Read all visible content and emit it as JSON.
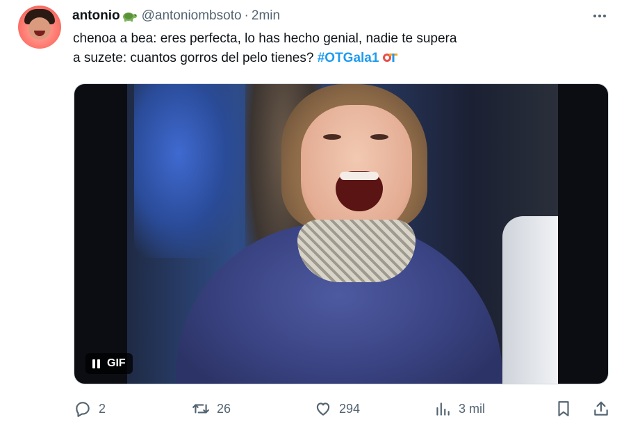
{
  "author": {
    "name": "antonio",
    "name_emoji_icon": "turtle-icon",
    "handle": "@antoniombsoto",
    "separator": "·",
    "time": "2min"
  },
  "tweet": {
    "line1": "chenoa a bea: eres perfecta, lo has hecho genial, nadie te supera",
    "line2_prefix": "a suzete: cuantos gorros del pelo tienes?",
    "hashtag": "#OTGala1",
    "hashtag_icon": "ot-logo-icon"
  },
  "media": {
    "type": "gif",
    "badge_label": "GIF",
    "control_icon": "pause-icon"
  },
  "actions": {
    "replies": "2",
    "retweets": "26",
    "likes": "294",
    "views": "3 mil"
  },
  "colors": {
    "text": "#0f1419",
    "secondary": "#536471",
    "hashtag": "#1d9bf0",
    "border": "#cfd9de"
  }
}
